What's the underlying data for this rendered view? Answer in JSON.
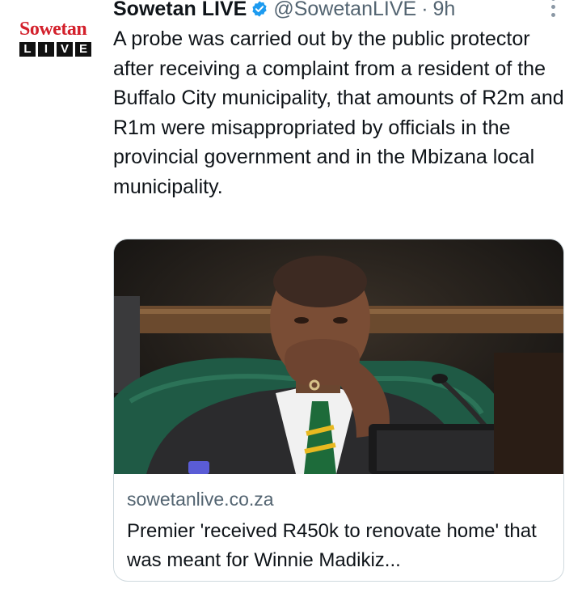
{
  "author": {
    "avatar_text_top": "Sowetan",
    "avatar_text_bottom": [
      "L",
      "I",
      "V",
      "E"
    ],
    "display_name": "Sowetan LIVE",
    "handle": "@SowetanLIVE",
    "separator": "·",
    "time": "9h",
    "verified_icon": "verified-badge-icon",
    "verified_color": "#1d9bf0"
  },
  "tweet": {
    "text": "A probe was carried out by the public protector after receiving a complaint from a resident of the Buffalo City municipality, that amounts of R2m and R1m were misappropriated by officials in the provincial government and in the Mbizana local municipality."
  },
  "card": {
    "image_icon": "news-photo-man-in-parliament",
    "domain": "sowetanlive.co.za",
    "title": "Premier 'received R450k to renovate home' that was meant for Winnie Madikiz..."
  },
  "colors": {
    "brand_red": "#d3202b",
    "text_primary": "#0f1419",
    "text_secondary": "#536471",
    "border": "#cfd9de"
  }
}
